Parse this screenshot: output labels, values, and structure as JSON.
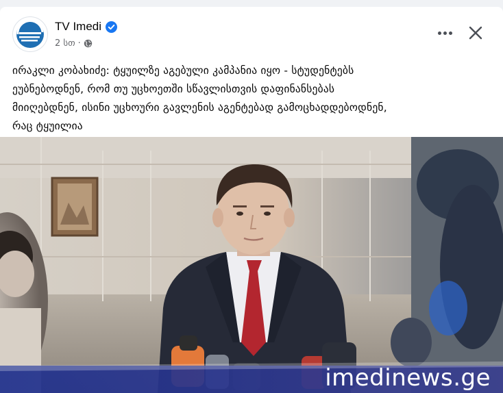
{
  "post": {
    "page_name": "TV Imedi",
    "verified_icon": "verified-badge-icon",
    "time": "2 სთ",
    "separator": "·",
    "audience_icon": "globe-icon",
    "more_icon": "more-options-icon",
    "close_icon": "close-icon",
    "text": "ირაკლი კობახიძე: ტყუილზე აგებული კამპანია იყო - სტუდენტებს\nეუბნებოდნენ, რომ თუ უცხოეთში სწავლისთვის დაფინანსებას\nმიიღებდნენ, ისინი უცხოური გავლენის აგენტებად გამოცხადდებოდნენ,\nრაც ტყუილია"
  },
  "image": {
    "watermark": "imedinews.ge"
  },
  "colors": {
    "accent": "#1877f2",
    "logo_blue": "#1f6fb3",
    "watermark_bar": "#2c3a8a"
  }
}
